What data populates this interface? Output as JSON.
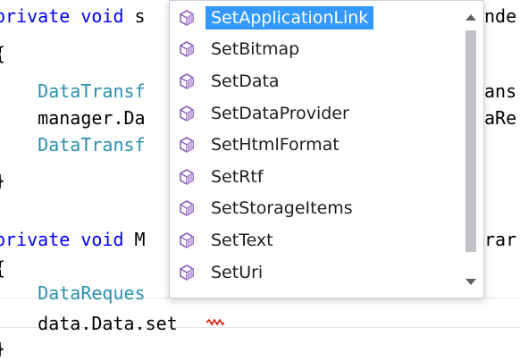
{
  "editor": {
    "lines": [
      {
        "parts": [
          {
            "cls": "kw",
            "text": "private"
          },
          {
            "cls": "plain",
            "text": " "
          },
          {
            "cls": "kw",
            "text": "void"
          },
          {
            "cls": "plain",
            "text": " s"
          }
        ],
        "right": "nde"
      },
      {
        "parts": [
          {
            "cls": "plain",
            "text": "{"
          }
        ],
        "right": ""
      },
      {
        "parts": [
          {
            "cls": "plain",
            "text": "    "
          },
          {
            "cls": "type",
            "text": "DataTransf"
          }
        ],
        "right": "ans"
      },
      {
        "parts": [
          {
            "cls": "plain",
            "text": "    manager.Da"
          }
        ],
        "right": "aRe"
      },
      {
        "parts": [
          {
            "cls": "plain",
            "text": "    "
          },
          {
            "cls": "type",
            "text": "DataTransf"
          }
        ],
        "right": ""
      },
      {
        "parts": [
          {
            "cls": "plain",
            "text": "}"
          }
        ],
        "right": ""
      },
      {
        "parts": [
          {
            "cls": "plain",
            "text": ""
          }
        ],
        "right": ""
      },
      {
        "parts": [
          {
            "cls": "kw",
            "text": "private"
          },
          {
            "cls": "plain",
            "text": " "
          },
          {
            "cls": "kw",
            "text": "void"
          },
          {
            "cls": "plain",
            "text": " M"
          }
        ],
        "right": "rar"
      },
      {
        "parts": [
          {
            "cls": "plain",
            "text": "{"
          }
        ],
        "right": ""
      },
      {
        "parts": [
          {
            "cls": "plain",
            "text": "    "
          },
          {
            "cls": "type",
            "text": "DataReques"
          }
        ],
        "right": ""
      },
      {
        "parts": [
          {
            "cls": "plain",
            "text": "    data.Data.set"
          }
        ],
        "right": ""
      },
      {
        "parts": [
          {
            "cls": "plain",
            "text": "}"
          }
        ],
        "right": ""
      }
    ]
  },
  "completion": {
    "items": [
      {
        "label": "SetApplicationLink",
        "icon": "method-icon",
        "selected": true
      },
      {
        "label": "SetBitmap",
        "icon": "method-icon",
        "selected": false
      },
      {
        "label": "SetData",
        "icon": "method-icon",
        "selected": false
      },
      {
        "label": "SetDataProvider",
        "icon": "method-icon",
        "selected": false
      },
      {
        "label": "SetHtmlFormat",
        "icon": "method-icon",
        "selected": false
      },
      {
        "label": "SetRtf",
        "icon": "method-icon",
        "selected": false
      },
      {
        "label": "SetStorageItems",
        "icon": "method-icon",
        "selected": false
      },
      {
        "label": "SetText",
        "icon": "method-icon",
        "selected": false
      },
      {
        "label": "SetUri",
        "icon": "method-icon",
        "selected": false
      }
    ],
    "scroll_up_icon": "chevron-up-icon",
    "scroll_down_icon": "chevron-down-icon"
  },
  "colors": {
    "keyword": "#0000ff",
    "type": "#2b91af",
    "selection": "#3399ff",
    "method_icon": "#8e5fb8",
    "squiggle": "#e51400"
  }
}
